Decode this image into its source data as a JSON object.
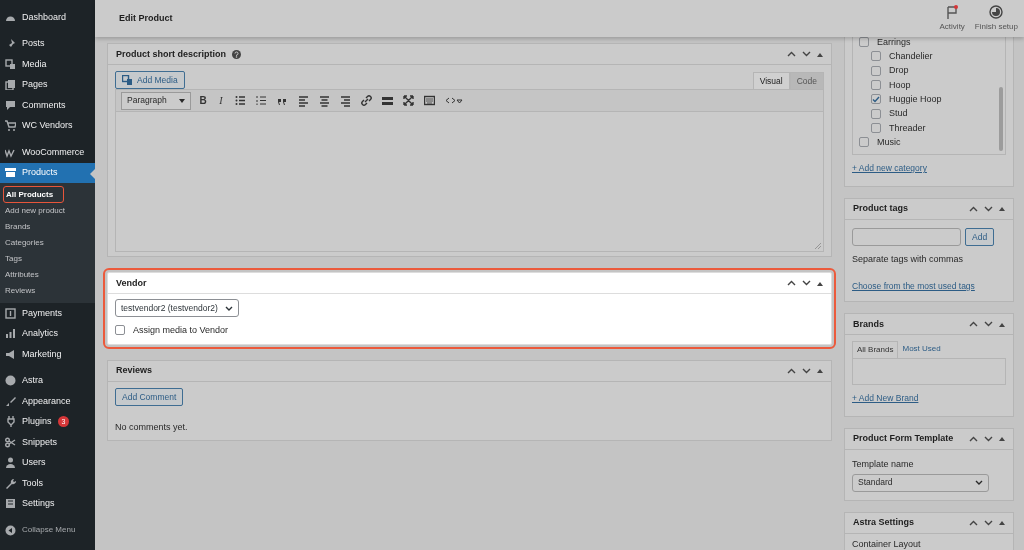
{
  "sidebar": {
    "groups": [
      {
        "items": [
          {
            "label": "Dashboard",
            "selected": false
          }
        ]
      },
      {
        "items": [
          {
            "label": "Posts",
            "selected": false
          },
          {
            "label": "Media",
            "selected": false
          },
          {
            "label": "Pages",
            "selected": false
          },
          {
            "label": "Comments",
            "selected": false
          },
          {
            "label": "WC Vendors",
            "selected": false
          }
        ]
      },
      {
        "items": [
          {
            "label": "WooCommerce",
            "selected": false
          },
          {
            "label": "Products",
            "selected": true,
            "children": [
              {
                "label": "All Products",
                "selected": true,
                "annotated": true
              },
              {
                "label": "Add new product",
                "selected": false,
                "annotated": false
              },
              {
                "label": "Brands",
                "selected": false,
                "annotated": false
              },
              {
                "label": "Categories",
                "selected": false,
                "annotated": false
              },
              {
                "label": "Tags",
                "selected": false,
                "annotated": false
              },
              {
                "label": "Attributes",
                "selected": false,
                "annotated": false
              },
              {
                "label": "Reviews",
                "selected": false,
                "annotated": false
              }
            ]
          },
          {
            "label": "Payments",
            "selected": false
          },
          {
            "label": "Analytics",
            "selected": false
          },
          {
            "label": "Marketing",
            "selected": false
          }
        ]
      },
      {
        "items": [
          {
            "label": "Astra",
            "selected": false
          },
          {
            "label": "Appearance",
            "selected": false
          },
          {
            "label": "Plugins",
            "selected": false,
            "badge": "3"
          },
          {
            "label": "Snippets",
            "selected": false
          },
          {
            "label": "Users",
            "selected": false
          },
          {
            "label": "Tools",
            "selected": false
          },
          {
            "label": "Settings",
            "selected": false
          }
        ]
      }
    ],
    "collapse": "Collapse Menu"
  },
  "header": {
    "title": "Edit Product",
    "actions": [
      {
        "label": "Activity",
        "unread": true
      },
      {
        "label": "Finish setup",
        "unread": false
      }
    ]
  },
  "main_panels": [
    {
      "kind": "editor",
      "title": "Product short description",
      "highlighted": false,
      "add_media": "Add Media",
      "tabs": [
        {
          "label": "Visual",
          "selected": true
        },
        {
          "label": "Code",
          "selected": false
        }
      ],
      "format": "Paragraph",
      "toolbar": [
        {
          "kind": "bold",
          "label": "B"
        },
        {
          "kind": "italic",
          "label": "I"
        },
        {
          "kind": "bullets"
        },
        {
          "kind": "numbers"
        },
        {
          "kind": "quote"
        },
        {
          "kind": "left"
        },
        {
          "kind": "center"
        },
        {
          "kind": "right"
        },
        {
          "kind": "link"
        },
        {
          "kind": "more"
        },
        {
          "kind": "fullscreen"
        },
        {
          "kind": "keyboard"
        },
        {
          "kind": "code"
        }
      ]
    },
    {
      "kind": "vendor",
      "title": "Vendor",
      "highlighted": true,
      "select": "testvendor2 (testvendor2)",
      "checkbox": {
        "label": "Assign media to Vendor",
        "checked": false
      }
    },
    {
      "kind": "reviews",
      "title": "Reviews",
      "highlighted": false,
      "button": "Add Comment",
      "text": "No comments yet."
    }
  ],
  "side_panels": [
    {
      "kind": "categories",
      "highlighted": false,
      "categories": [
        {
          "label": "Earrings",
          "checked": false,
          "children": [
            {
              "label": "Chandelier",
              "checked": false
            },
            {
              "label": "Drop",
              "checked": false
            },
            {
              "label": "Hoop",
              "checked": false
            },
            {
              "label": "Huggie Hoop",
              "checked": true
            },
            {
              "label": "Stud",
              "checked": false
            },
            {
              "label": "Threader",
              "checked": false
            }
          ]
        },
        {
          "label": "Music",
          "checked": false
        }
      ],
      "link": "+ Add new category"
    },
    {
      "kind": "tags",
      "title": "Product tags",
      "highlighted": false,
      "button": "Add",
      "hint": "Separate tags with commas",
      "link": "Choose from the most used tags"
    },
    {
      "kind": "brands",
      "title": "Brands",
      "highlighted": false,
      "tabs": [
        {
          "label": "All Brands",
          "selected": true
        },
        {
          "label": "Most Used",
          "selected": false
        }
      ],
      "link": "+ Add New Brand"
    },
    {
      "kind": "template",
      "title": "Product Form Template",
      "highlighted": false,
      "label": "Template name",
      "select": "Standard"
    },
    {
      "kind": "astra",
      "title": "Astra Settings",
      "highlighted": false,
      "label": "Container Layout"
    }
  ]
}
